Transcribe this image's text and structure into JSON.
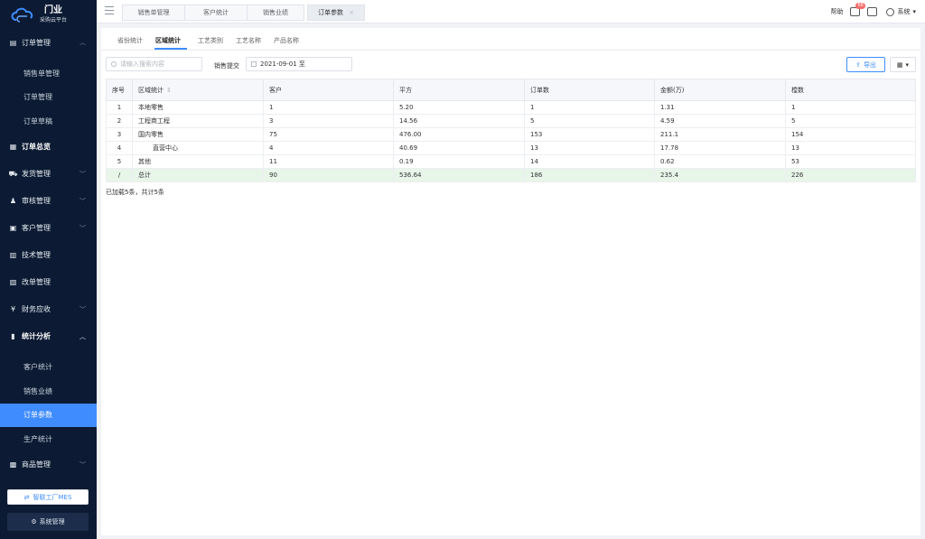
{
  "brand": {
    "title": "门业",
    "subtitle": "采购云平台"
  },
  "sidebar": {
    "order_mgmt": {
      "label": "订单管理",
      "items": [
        "销售单管理",
        "订单管理",
        "订单草稿"
      ]
    },
    "order_overview": "订单总览",
    "shipping": "发货管理",
    "review": "审核管理",
    "customer": "客户管理",
    "tech": "技术管理",
    "change_order": "改单管理",
    "finance": "财务应收",
    "stats": {
      "label": "统计分析",
      "items": [
        "客户统计",
        "销售业绩",
        "订单参数",
        "生产统计"
      ]
    },
    "goods": "商品管理",
    "mes_button": "智联工厂MES",
    "system_button": "系统管理"
  },
  "topbar": {
    "tabs": [
      "销售单管理",
      "客户统计",
      "销售业绩",
      "订单参数"
    ],
    "help": "帮助",
    "badge": "68",
    "user": "系统"
  },
  "subtabs": [
    "省份统计",
    "区域统计",
    "工艺类别",
    "工艺名称",
    "产品名称"
  ],
  "filters": {
    "search_placeholder": "请输入搜索内容",
    "date_label": "销售提交",
    "date_value": "2021-09-01 至",
    "export_label": "导出"
  },
  "table": {
    "headers": [
      "序号",
      "区域统计",
      "客户",
      "平方",
      "订单数",
      "金额(万)",
      "樘数"
    ],
    "rows": [
      [
        "1",
        "本地零售",
        "1",
        "5.20",
        "1",
        "1.31",
        "1"
      ],
      [
        "2",
        "工程商工程",
        "3",
        "14.56",
        "5",
        "4.59",
        "5"
      ],
      [
        "3",
        "国内零售",
        "75",
        "476.00",
        "153",
        "211.1",
        "154"
      ],
      [
        "4",
        "直营中心",
        "4",
        "40.69",
        "13",
        "17.78",
        "13"
      ],
      [
        "5",
        "其他",
        "11",
        "0.19",
        "14",
        "0.62",
        "53"
      ]
    ],
    "total": [
      "/",
      "总计",
      "90",
      "536.64",
      "186",
      "235.4",
      "226"
    ]
  },
  "footer_note": "已加载5条，共计5条"
}
